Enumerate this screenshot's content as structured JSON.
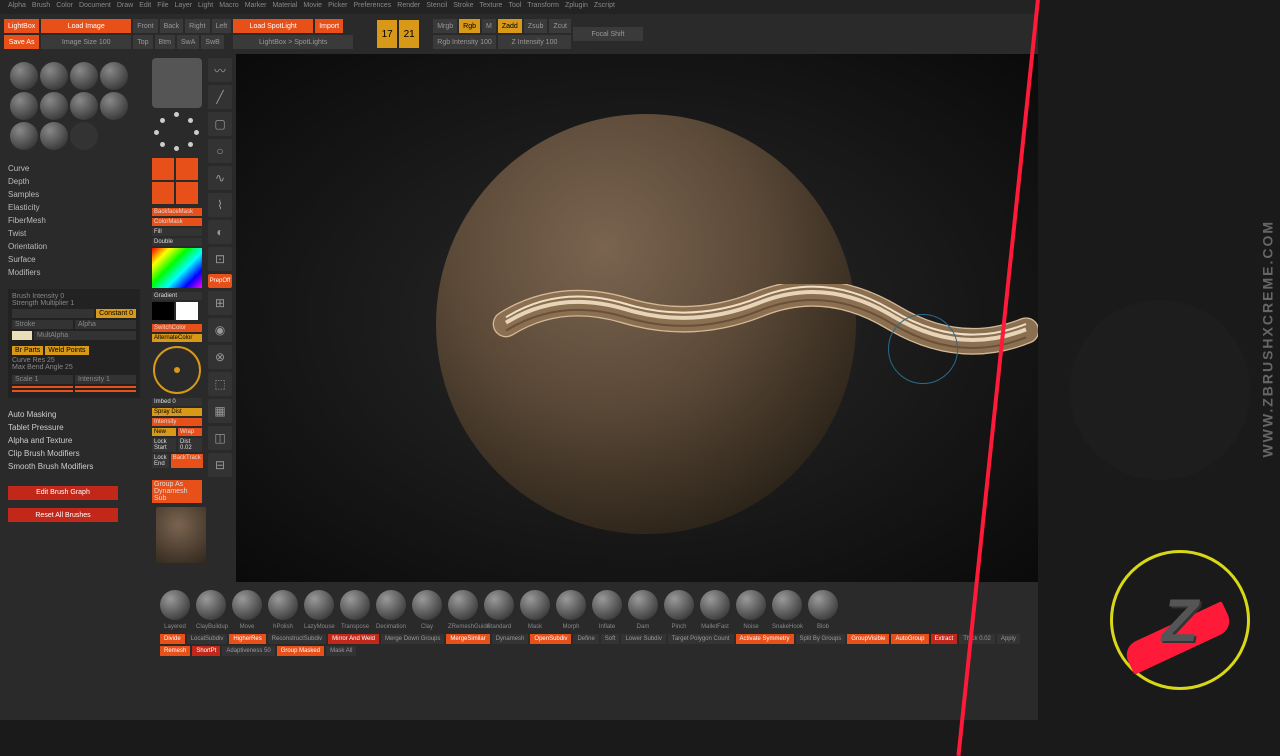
{
  "menu": [
    "Alpha",
    "Brush",
    "Color",
    "Document",
    "Draw",
    "Edit",
    "File",
    "Layer",
    "Light",
    "Macro",
    "Marker",
    "Material",
    "Movie",
    "Picker",
    "Preferences",
    "Render",
    "Stencil",
    "Stroke",
    "Texture",
    "Tool",
    "Transform",
    "Zplugin",
    "Zscript"
  ],
  "topbar": {
    "lightbox": "LightBox",
    "load": "Load Image",
    "saveAs": "Save As",
    "front": "Front",
    "back": "Back",
    "right": "Right",
    "left": "Left",
    "loadSpot": "Load SpotLight",
    "import": "Import",
    "top": "Top",
    "btm": "Btm",
    "swA": "SwA",
    "swB": "SwB",
    "lbsp": "LightBox > SpotLights",
    "mrgb": "Mrgb",
    "rgb": "Rgb",
    "m": "M",
    "zadd": "Zadd",
    "zsub": "Zsub",
    "zcut": "Zcut",
    "rgbInt": "Rgb Intensity 100",
    "zInt": "Z Intensity 100",
    "focal": "Focal Shift",
    "imgSize": "Image Size 100",
    "17": "17",
    "21": "21"
  },
  "leftList": [
    "Curve",
    "Depth",
    "Samples",
    "Elasticity",
    "FiberMesh",
    "Twist",
    "Orientation",
    "Surface",
    "Modifiers"
  ],
  "brushProps": {
    "title": "Brush Intensity 0",
    "strength": "Strength  Multiplier 1",
    "constant": "Constant 0",
    "stroke": "Stroke",
    "alpha": "Alpha",
    "multAlpha": "MultAlpha",
    "weld": "Weld Points",
    "brParts": "Br Parts",
    "curveRes": "Curve Res 25",
    "maxBend": "Max Bend Angle 25",
    "scale": "Scale 1",
    "intensity": "Intensity 1"
  },
  "bottomList": [
    "Auto Masking",
    "Tablet Pressure",
    "Alpha and Texture",
    "Clip Brush Modifiers",
    "Smooth Brush Modifiers"
  ],
  "leftBtns": {
    "edit": "Edit Brush Graph",
    "reset": "Reset All Brushes"
  },
  "toolCol": {
    "backface": "BackfaceMask",
    "colorMask": "ColorMask",
    "fill": "Fill",
    "double": "Double",
    "switch": "SwitchColor",
    "alt": "AlternateColor",
    "gradient": "Gradient",
    "imbed": "Imbed 0",
    "sprayDist": "Spray Dist",
    "intensity": "Intensity",
    "new": "New",
    "wrap": "Wrap",
    "lockStart": "Lock Start",
    "lockEnd": "Lock End",
    "dist": "Dist 0.02",
    "backtrack": "BackTrack",
    "prepOff": "PrepOff"
  },
  "bottomBar": {
    "brushes": [
      "Layered",
      "ClayBuildup",
      "Move",
      "hPolish",
      "LazyMouse",
      "Transpose",
      "Decimation",
      "Clay",
      "ZRemeshGuide",
      "Standard",
      "Mask",
      "Morph",
      "Inflate",
      "Dam",
      "Pinch",
      "MalletFast",
      "Noise",
      "SnakeHook",
      "Blob"
    ],
    "group": "Group As Dynamesh Sub",
    "btns": [
      "Divide",
      "LocalSubdiv",
      "HigherRes",
      "ReconstructSubdiv",
      "Mirror And Weld",
      "Merge Down Groups",
      "MergeSimilar",
      "Dynamesh",
      "OpenSubdiv",
      "Define",
      "Soft",
      "Lower Subdiv",
      "Target Polygon Count",
      "Activate Symmetry",
      "Split By Groups",
      "GroupVisible",
      "AutoGroup",
      "Extract",
      "Thick 0.02",
      "Apply",
      "Remesh",
      "ShortPt",
      "Adaptiveness 50",
      "Group Masked",
      "Mask All"
    ]
  },
  "brand": {
    "url": "WWW.ZBRUSHXCREME.COM"
  }
}
